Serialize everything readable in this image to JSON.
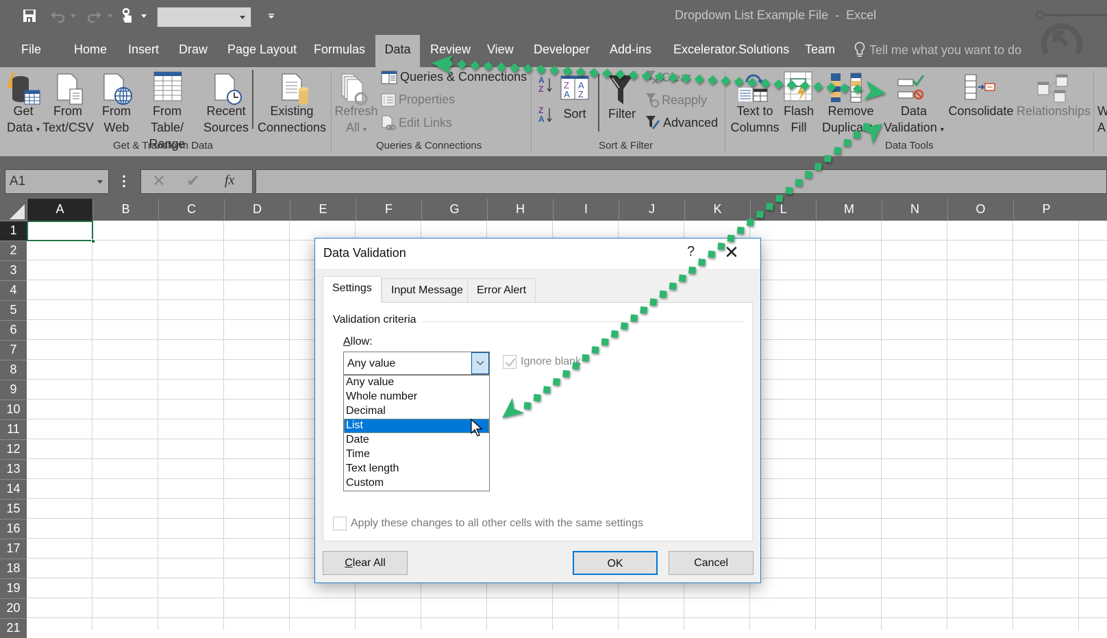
{
  "window": {
    "title": "Dropdown List Example File  -  Excel",
    "quick_access": {
      "save_icon": "save-icon",
      "undo_icon": "undo-icon",
      "redo_icon": "redo-icon",
      "touch_mode_icon": "touch-mode-icon",
      "combo_value": "",
      "customize_icon": "customize-qat-icon"
    }
  },
  "tabs": [
    {
      "label": "File"
    },
    {
      "label": "Home"
    },
    {
      "label": "Insert"
    },
    {
      "label": "Draw"
    },
    {
      "label": "Page Layout"
    },
    {
      "label": "Formulas"
    },
    {
      "label": "Data",
      "active": true
    },
    {
      "label": "Review"
    },
    {
      "label": "View"
    },
    {
      "label": "Developer"
    },
    {
      "label": "Add-ins"
    },
    {
      "label": "Excelerator.Solutions"
    },
    {
      "label": "Team"
    }
  ],
  "tell_me": "Tell me what you want to do",
  "ribbon": {
    "groups": {
      "get_transform": {
        "label": "Get & Transform Data",
        "buttons": {
          "get_data": {
            "line1": "Get",
            "line2": "Data"
          },
          "from_text": {
            "line1": "From",
            "line2": "Text/CSV"
          },
          "from_web": {
            "line1": "From",
            "line2": "Web"
          },
          "from_table": {
            "line1": "From Table/",
            "line2": "Range"
          },
          "recent_sources": {
            "line1": "Recent",
            "line2": "Sources"
          },
          "existing_connections": {
            "line1": "Existing",
            "line2": "Connections"
          }
        }
      },
      "queries": {
        "label": "Queries & Connections",
        "refresh_all": {
          "line1": "Refresh",
          "line2": "All"
        },
        "queries_connections": "Queries & Connections",
        "properties": "Properties",
        "edit_links": "Edit Links"
      },
      "sort_filter": {
        "label": "Sort & Filter",
        "sort": "Sort",
        "filter": "Filter",
        "clear": "Clear",
        "reapply": "Reapply",
        "advanced": "Advanced"
      },
      "data_tools": {
        "label": "Data Tools",
        "text_to_columns": {
          "line1": "Text to",
          "line2": "Columns"
        },
        "flash_fill": {
          "line1": "Flash",
          "line2": "Fill"
        },
        "remove_duplicates": {
          "line1": "Remove",
          "line2": "Duplicates"
        },
        "data_validation": {
          "line1": "Data",
          "line2": "Validation"
        },
        "consolidate": "Consolidate",
        "relationships": "Relationships"
      },
      "next_partial": {
        "line1": "W",
        "line2": "A"
      }
    }
  },
  "formula_bar": {
    "name_box": "A1",
    "cancel_icon": "cancel-icon",
    "enter_icon": "enter-icon",
    "fx_label": "fx",
    "formula": ""
  },
  "sheet": {
    "columns": [
      "A",
      "B",
      "C",
      "D",
      "E",
      "F",
      "G",
      "H",
      "I",
      "J",
      "K",
      "L",
      "M",
      "N",
      "O",
      "P"
    ],
    "rows": [
      "1",
      "2",
      "3",
      "4",
      "5",
      "6",
      "7",
      "8",
      "9",
      "10",
      "11",
      "12",
      "13",
      "14",
      "15",
      "16",
      "17",
      "18",
      "19",
      "20",
      "21"
    ],
    "active_cell": "A1"
  },
  "dialog": {
    "title": "Data Validation",
    "help": "?",
    "tabs": [
      "Settings",
      "Input Message",
      "Error Alert"
    ],
    "active_tab": "Settings",
    "criteria_label": "Validation criteria",
    "allow_label_u": "A",
    "allow_label_rest": "llow:",
    "allow_value": "Any value",
    "allow_options": [
      "Any value",
      "Whole number",
      "Decimal",
      "List",
      "Date",
      "Time",
      "Text length",
      "Custom"
    ],
    "highlighted_option": "List",
    "ignore_blank": {
      "label": "Ignore blank",
      "checked": true,
      "enabled": false
    },
    "apply_all": {
      "label": "Apply these changes to all other cells with the same settings",
      "checked": false,
      "enabled": false
    },
    "clear_all_u": "C",
    "clear_all_rest": "lear All",
    "ok": "OK",
    "cancel": "Cancel"
  },
  "annotation": {
    "arrow_color": "#2db56e"
  }
}
